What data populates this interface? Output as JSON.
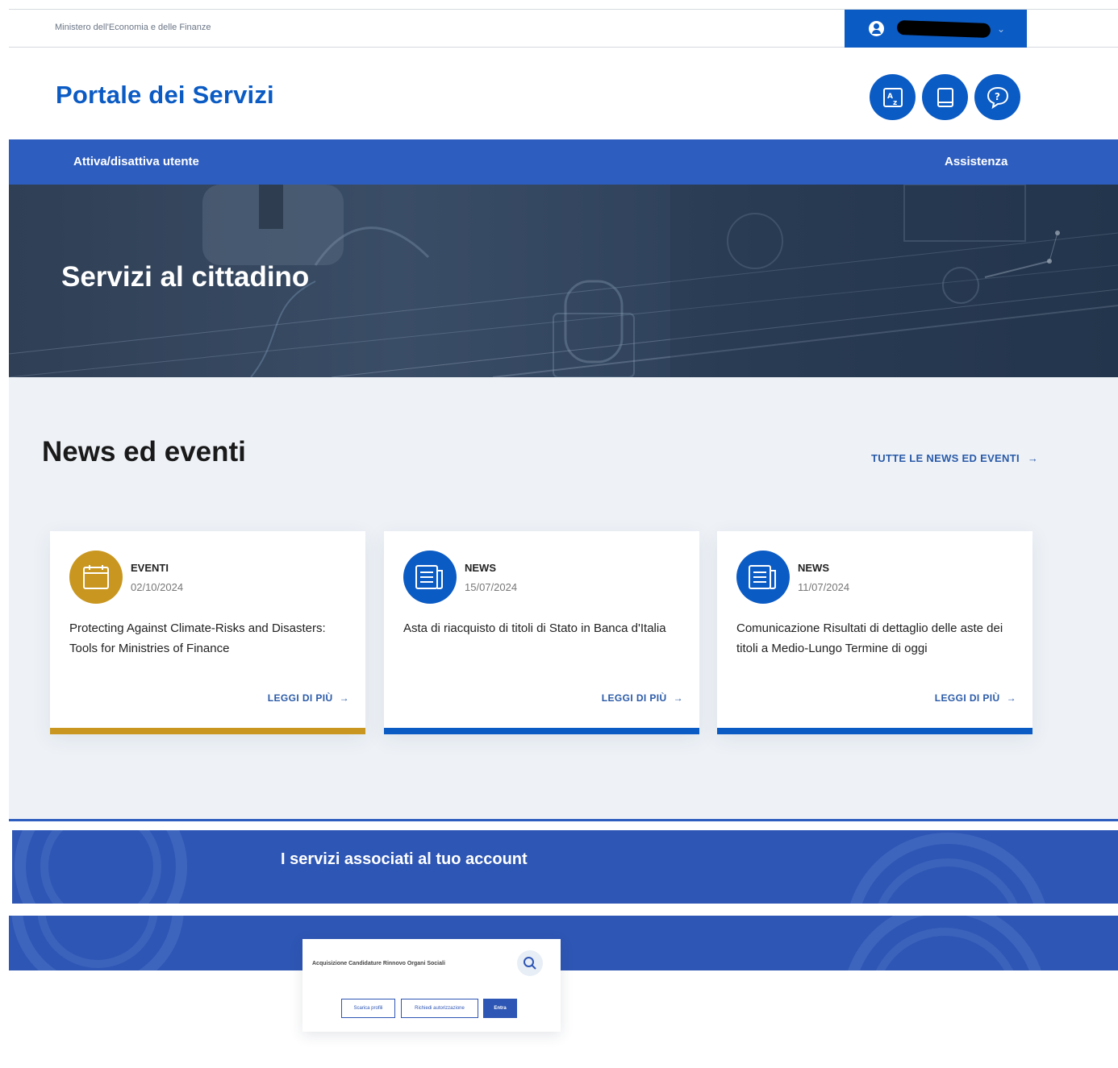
{
  "topbar": {
    "ministry": "Ministero dell'Economia e delle Finanze",
    "user_chevron": "⌄"
  },
  "header": {
    "title": "Portale dei Servizi",
    "icons": [
      "translate-icon",
      "book-icon",
      "help-chat-icon"
    ]
  },
  "nav": {
    "left_link": "Attiva/disattiva utente",
    "right_link": "Assistenza"
  },
  "hero": {
    "title": "Servizi al cittadino"
  },
  "news": {
    "title": "News ed eventi",
    "all_link": "TUTTE LE NEWS ED EVENTI",
    "arrow": "→",
    "cards": [
      {
        "type": "EVENTI",
        "date": "02/10/2024",
        "text": "Protecting Against Climate-Risks and Disasters: Tools for Ministries of Finance",
        "more": "LEGGI DI PIÙ",
        "color": "#c9971f",
        "icon": "calendar-icon"
      },
      {
        "type": "NEWS",
        "date": "15/07/2024",
        "text": "Asta di riacquisto di titoli di Stato in Banca d'Italia",
        "more": "LEGGI DI PIÙ",
        "color": "#0b5bc4",
        "icon": "news-icon"
      },
      {
        "type": "NEWS",
        "date": "11/07/2024",
        "text": "Comunicazione Risultati di dettaglio delle aste dei titoli a Medio-Lungo Termine di oggi",
        "more": "LEGGI DI PIÙ",
        "color": "#0b5bc4",
        "icon": "news-icon"
      }
    ]
  },
  "accounts": {
    "title": "I servizi associati al tuo account"
  },
  "search_card": {
    "label": "Acquisizione Candidature Rinnovo Organi Sociali",
    "btn1": "Scarica profili",
    "btn2": "Richiedi autorizzazione",
    "btn3": "Entra"
  },
  "colors": {
    "primary": "#0b5bc4",
    "nav": "#2d5dbf",
    "accent_gold": "#c9971f"
  }
}
